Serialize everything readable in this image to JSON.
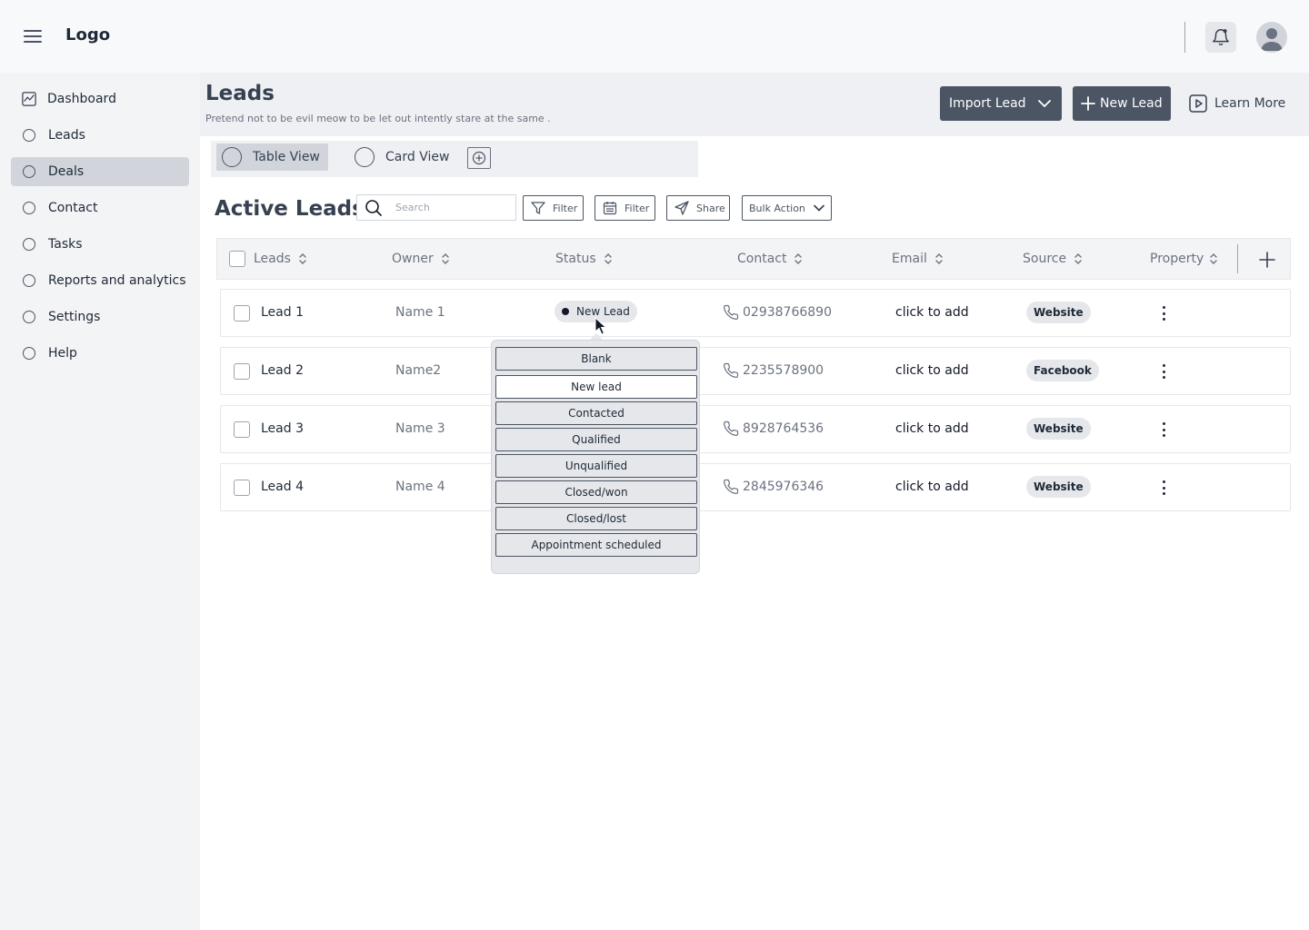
{
  "app": {
    "logo": "Logo"
  },
  "sidebar": {
    "items": [
      {
        "label": "Dashboard",
        "icon": "chart-icon"
      },
      {
        "label": "Leads",
        "icon": "circle-icon"
      },
      {
        "label": "Deals",
        "icon": "circle-icon",
        "active": true
      },
      {
        "label": "Contact",
        "icon": "circle-icon"
      },
      {
        "label": "Tasks",
        "icon": "circle-icon"
      },
      {
        "label": "Reports and analytics",
        "icon": "circle-icon"
      },
      {
        "label": "Settings",
        "icon": "circle-icon"
      },
      {
        "label": "Help",
        "icon": "circle-icon"
      }
    ]
  },
  "header": {
    "title": "Leads",
    "subtitle": "Pretend not to be evil meow to be let out intently stare at the same .",
    "import_label": "Import Lead",
    "new_label": "New Lead",
    "learn_label": "Learn More"
  },
  "views": {
    "table": "Table View",
    "card": "Card View"
  },
  "toolbar": {
    "section_title": "Active Leads",
    "search_placeholder": "Search",
    "filter1": "Filter",
    "filter2": "Filter",
    "share": "Share",
    "bulk": "Bulk Action"
  },
  "table": {
    "columns": [
      "Leads",
      "Owner",
      "Status",
      "Contact",
      "Email",
      "Source",
      "Property"
    ],
    "rows": [
      {
        "lead": "Lead 1",
        "owner": "Name 1",
        "status": "New Lead",
        "contact": "02938766890",
        "email": "click to add",
        "source": "Website"
      },
      {
        "lead": "Lead 2",
        "owner": "Name2",
        "status": "",
        "contact": "2235578900",
        "email": "click to add",
        "source": "Facebook"
      },
      {
        "lead": "Lead 3",
        "owner": "Name 3",
        "status": "",
        "contact": "8928764536",
        "email": "click to add",
        "source": "Website"
      },
      {
        "lead": "Lead 4",
        "owner": "Name 4",
        "status": "",
        "contact": "2845976346",
        "email": "click to add",
        "source": "Website"
      }
    ]
  },
  "status_dropdown": {
    "options": [
      "Blank",
      "New lead",
      "Contacted",
      "Qualified",
      "Unqualified",
      "Closed/won",
      "Closed/lost",
      "Appointment scheduled"
    ],
    "selected": "New lead"
  },
  "colors": {
    "primary_button": "#4b5563",
    "sidebar_bg": "#f3f4f6",
    "header_bg": "#eef0f3"
  }
}
